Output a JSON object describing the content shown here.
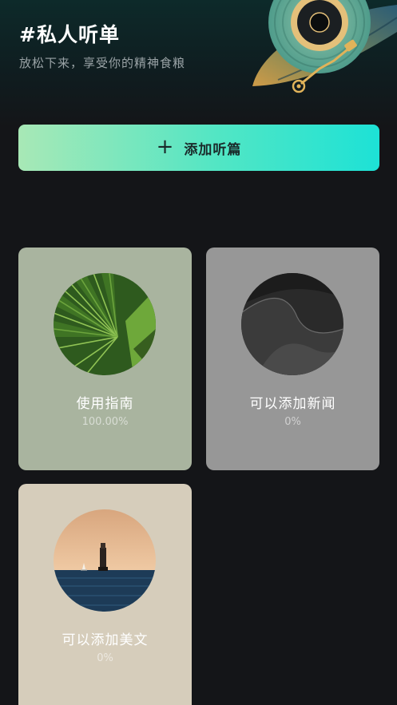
{
  "header": {
    "title": "#私人听单",
    "subtitle": "放松下来，享受你的精神食粮"
  },
  "add_button": {
    "icon": "plus-icon",
    "label": "添加听篇"
  },
  "cards": [
    {
      "name": "使用指南",
      "progress": "100.00%",
      "image": "palm-leaf"
    },
    {
      "name": "可以添加新闻",
      "progress": "0%",
      "image": "sand-dunes"
    },
    {
      "name": "可以添加美文",
      "progress": "0%",
      "image": "lighthouse-sea"
    }
  ],
  "colors": {
    "background": "#141518",
    "button_gradient_start": "#a8e8b6",
    "button_gradient_end": "#1de2d6",
    "card_green": "#a9b49f",
    "card_gray": "#979797",
    "card_beige": "#d6cdbb"
  }
}
